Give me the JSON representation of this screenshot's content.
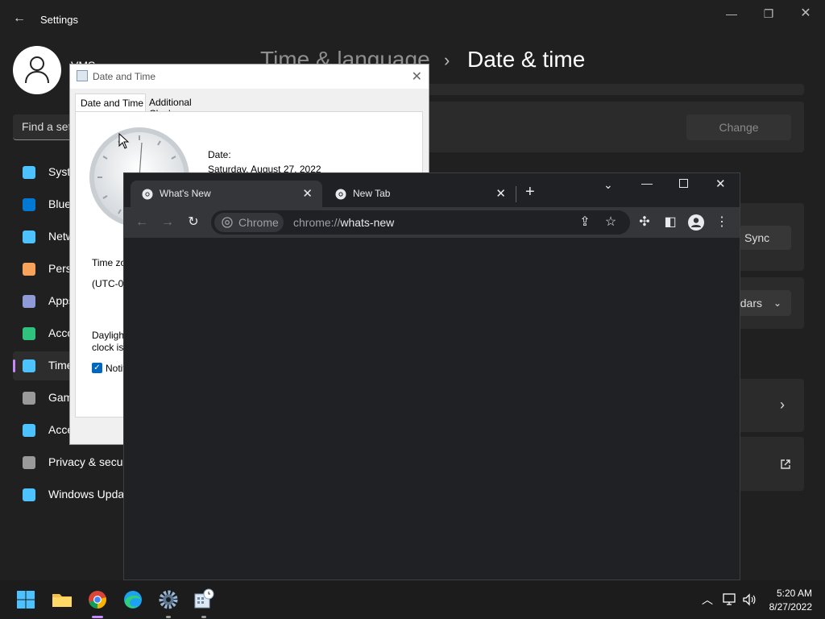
{
  "settings": {
    "title": "Settings",
    "user_name": "VMS",
    "search_placeholder": "Find a setting",
    "breadcrumb_parent": "Time & language",
    "breadcrumb_separator": "›",
    "breadcrumb_current": "Date & time",
    "nav": [
      {
        "label": "System",
        "icon": "monitor-icon",
        "color": "#4cc2ff"
      },
      {
        "label": "Bluetooth & devices",
        "icon": "bluetooth-icon",
        "color": "#0078d4"
      },
      {
        "label": "Network & internet",
        "icon": "wifi-icon",
        "color": "#4cc2ff"
      },
      {
        "label": "Personalization",
        "icon": "brush-icon",
        "color": "#f7a35c"
      },
      {
        "label": "Apps",
        "icon": "apps-icon",
        "color": "#8f9bd6"
      },
      {
        "label": "Accounts",
        "icon": "person-icon",
        "color": "#2ec27e"
      },
      {
        "label": "Time & language",
        "icon": "clock-globe-icon",
        "color": "#4cc2ff"
      },
      {
        "label": "Gaming",
        "icon": "controller-icon",
        "color": "#9a9a9a"
      },
      {
        "label": "Accessibility",
        "icon": "accessibility-icon",
        "color": "#4cc2ff"
      },
      {
        "label": "Privacy & security",
        "icon": "shield-icon",
        "color": "#9a9a9a"
      },
      {
        "label": "Windows Update",
        "icon": "update-icon",
        "color": "#4cc2ff"
      }
    ],
    "change_button": "Change",
    "sync_button": "Sync now",
    "calendars_button": "Show calendars"
  },
  "date_time_dialog": {
    "title": "Date and Time",
    "tabs": [
      "Date and Time",
      "Additional Clocks"
    ],
    "date_label": "Date:",
    "date_value": "Saturday, August 27, 2022",
    "time_zone_label": "Time zone",
    "time_zone_value": "(UTC-08:00)",
    "dst_line1": "Daylight Saving Time",
    "dst_line2": "clock is set",
    "notify_label": "Notify me"
  },
  "chrome": {
    "tabs": [
      {
        "title": "What's New",
        "active": true
      },
      {
        "title": "New Tab",
        "active": false
      }
    ],
    "chip_label": "Chrome",
    "url_scheme": "chrome://",
    "url_path": "whats-new"
  },
  "taskbar": {
    "apps": [
      "windows-start-icon",
      "file-explorer-icon",
      "chrome-icon",
      "edge-icon",
      "settings-gear-icon",
      "date-time-control-panel-icon"
    ],
    "time": "5:20 AM",
    "date": "8/27/2022"
  }
}
